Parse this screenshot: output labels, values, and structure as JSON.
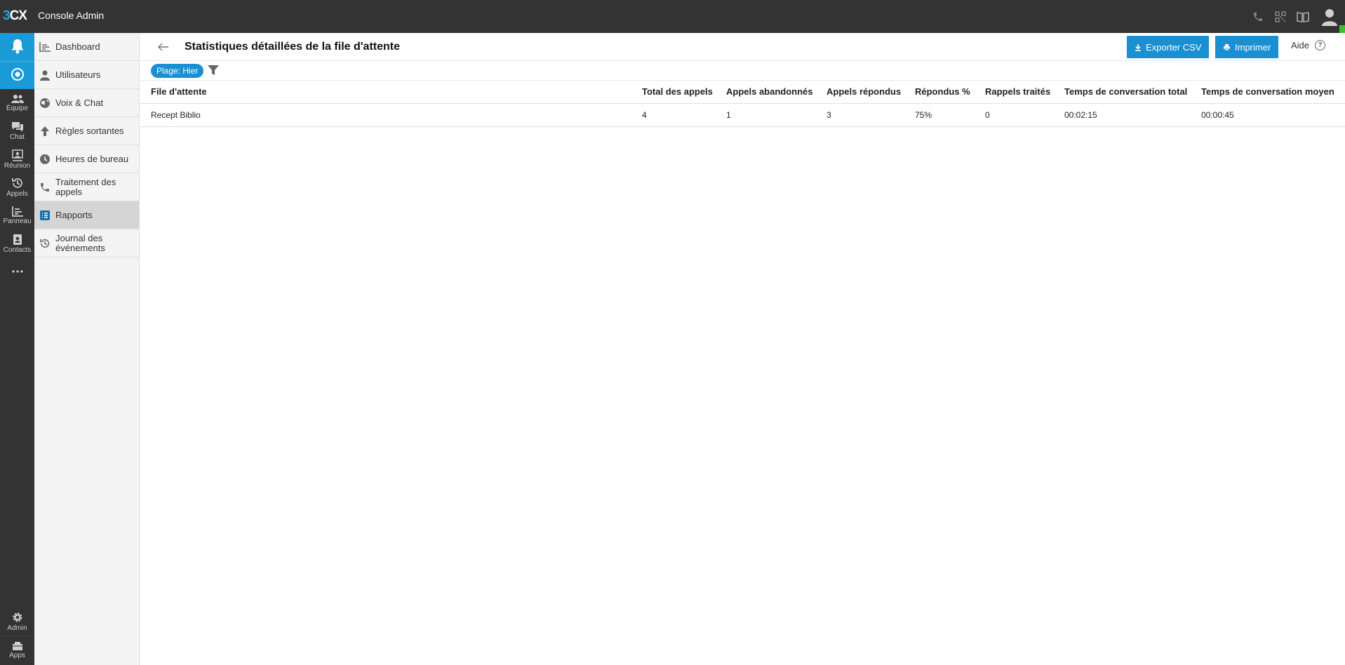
{
  "app": {
    "logo_text": "3CX",
    "title": "Console Admin"
  },
  "top_icons": [
    "phone-icon",
    "qr-code-icon",
    "book-icon",
    "user-avatar-icon"
  ],
  "rail": {
    "items": [
      {
        "icon": "bell-icon",
        "label": ""
      },
      {
        "icon": "admin-console-icon",
        "label": ""
      },
      {
        "icon": "team-icon",
        "label": "Équipe"
      },
      {
        "icon": "chat-icon",
        "label": "Chat"
      },
      {
        "icon": "meeting-icon",
        "label": "Réunion"
      },
      {
        "icon": "history-icon",
        "label": "Appels"
      },
      {
        "icon": "panel-icon",
        "label": "Panneau"
      },
      {
        "icon": "contacts-icon",
        "label": "Contacts"
      },
      {
        "icon": "more-icon",
        "label": ""
      }
    ],
    "bottom": [
      {
        "icon": "gear-icon",
        "label": "Admin"
      },
      {
        "icon": "apps-icon",
        "label": "Apps"
      }
    ]
  },
  "subnav": {
    "items": [
      {
        "icon": "dashboard-icon",
        "label": "Dashboard"
      },
      {
        "icon": "user-icon",
        "label": "Utilisateurs"
      },
      {
        "icon": "globe-icon",
        "label": "Voix & Chat"
      },
      {
        "icon": "arrow-up-icon",
        "label": "Règles sortantes"
      },
      {
        "icon": "clock-icon",
        "label": "Heures de bureau"
      },
      {
        "icon": "phone-icon",
        "label": "Traitement des appels"
      },
      {
        "icon": "report-icon",
        "label": "Rapports"
      },
      {
        "icon": "history-icon",
        "label": "Journal des événements"
      }
    ],
    "active": "Rapports"
  },
  "header": {
    "title": "Statistiques détaillées de la file d'attente",
    "export_label": "Exporter CSV",
    "print_label": "Imprimer",
    "help_label": "Aide"
  },
  "filter": {
    "chip_label": "Plage: Hier"
  },
  "table": {
    "columns": [
      "File d'attente",
      "Total des appels",
      "Appels abandonnés",
      "Appels répondus",
      "Répondus %",
      "Rappels traités",
      "Temps de conversation total",
      "Temps de conversation moyen"
    ],
    "rows": [
      [
        "Recept Biblio",
        "4",
        "1",
        "3",
        "75%",
        "0",
        "00:02:15",
        "00:00:45"
      ]
    ]
  },
  "colors": {
    "topbar": "#333333",
    "accent": "#1a8fd1",
    "status_online": "#3cc12c"
  }
}
